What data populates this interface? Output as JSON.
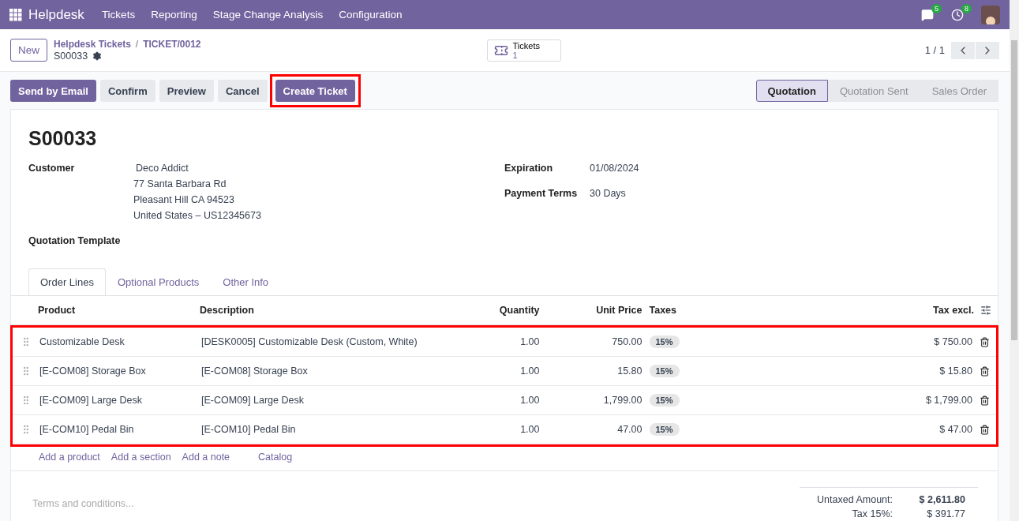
{
  "navbar": {
    "app": "Helpdesk",
    "menus": [
      "Tickets",
      "Reporting",
      "Stage Change Analysis",
      "Configuration"
    ],
    "messages_count": "5",
    "activities_count": "8"
  },
  "control_panel": {
    "new_button": "New",
    "breadcrumb": [
      "Helpdesk Tickets",
      "TICKET/0012"
    ],
    "breadcrumb_separator": "/",
    "record": "S00033",
    "smart_button": {
      "label": "Tickets",
      "value": "1"
    },
    "pager": "1 / 1"
  },
  "actions": [
    {
      "label": "Send by Email",
      "primary": true,
      "highlighted": false
    },
    {
      "label": "Confirm",
      "primary": false,
      "highlighted": false
    },
    {
      "label": "Preview",
      "primary": false,
      "highlighted": false
    },
    {
      "label": "Cancel",
      "primary": false,
      "highlighted": false
    },
    {
      "label": "Create Ticket",
      "primary": true,
      "highlighted": true
    }
  ],
  "stages": [
    {
      "label": "Quotation",
      "selected": true
    },
    {
      "label": "Quotation Sent",
      "selected": false
    },
    {
      "label": "Sales Order",
      "selected": false
    }
  ],
  "form": {
    "title": "S00033",
    "customer": {
      "label": "Customer",
      "name": "Deco Addict",
      "address": [
        "77 Santa Barbara Rd",
        "Pleasant Hill CA 94523",
        "United States – US12345673"
      ]
    },
    "right_fields": [
      {
        "label": "Expiration",
        "value": "01/08/2024"
      },
      {
        "label": "Payment Terms",
        "value": "30 Days"
      }
    ],
    "template_label": "Quotation Template"
  },
  "tabs": [
    {
      "label": "Order Lines",
      "selected": true
    },
    {
      "label": "Optional Products",
      "selected": false
    },
    {
      "label": "Other Info",
      "selected": false
    }
  ],
  "table": {
    "columns": [
      "Product",
      "Description",
      "Quantity",
      "Unit Price",
      "Taxes",
      "Tax excl."
    ],
    "highlighted": true,
    "rows": [
      {
        "product": "Customizable Desk",
        "description": "[DESK0005] Customizable Desk (Custom, White)",
        "quantity": "1.00",
        "unit_price": "750.00",
        "tax": "15%",
        "subtotal": "$ 750.00"
      },
      {
        "product": "[E-COM08] Storage Box",
        "description": "[E-COM08] Storage Box",
        "quantity": "1.00",
        "unit_price": "15.80",
        "tax": "15%",
        "subtotal": "$ 15.80"
      },
      {
        "product": "[E-COM09] Large Desk",
        "description": "[E-COM09] Large Desk",
        "quantity": "1.00",
        "unit_price": "1,799.00",
        "tax": "15%",
        "subtotal": "$ 1,799.00"
      },
      {
        "product": "[E-COM10] Pedal Bin",
        "description": "[E-COM10] Pedal Bin",
        "quantity": "1.00",
        "unit_price": "47.00",
        "tax": "15%",
        "subtotal": "$ 47.00"
      }
    ],
    "add_links": [
      "Add a product",
      "Add a section",
      "Add a note",
      "Catalog"
    ]
  },
  "terms": {
    "placeholder": "Terms and conditions..."
  },
  "totals": [
    {
      "label": "Untaxed Amount:",
      "value": "$ 2,611.80",
      "bold": true
    },
    {
      "label": "Tax 15%:",
      "value": "$ 391.77",
      "bold": false
    }
  ]
}
